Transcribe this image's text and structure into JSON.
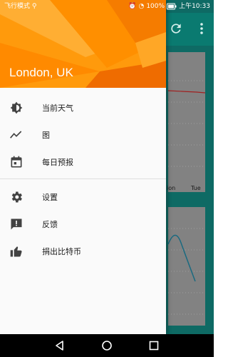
{
  "status_bar": {
    "left_text": "飞行模式",
    "battery": "100%",
    "time": "上午10:33"
  },
  "background": {
    "chart1_labels": [
      "ion",
      "Tue"
    ],
    "accent": "#0a7a70"
  },
  "drawer": {
    "location": "London, UK",
    "header_color": "#ff8a00",
    "items": [
      {
        "label": "当前天气",
        "icon": "brightness-icon"
      },
      {
        "label": "图",
        "icon": "trending-icon"
      },
      {
        "label": "每日预报",
        "icon": "calendar-icon"
      }
    ],
    "secondary_items": [
      {
        "label": "设置",
        "icon": "gear-icon"
      },
      {
        "label": "反馈",
        "icon": "feedback-icon"
      },
      {
        "label": "捐出比特币",
        "icon": "thumb-up-icon"
      }
    ]
  },
  "navigation": [
    "back",
    "home",
    "recents"
  ]
}
